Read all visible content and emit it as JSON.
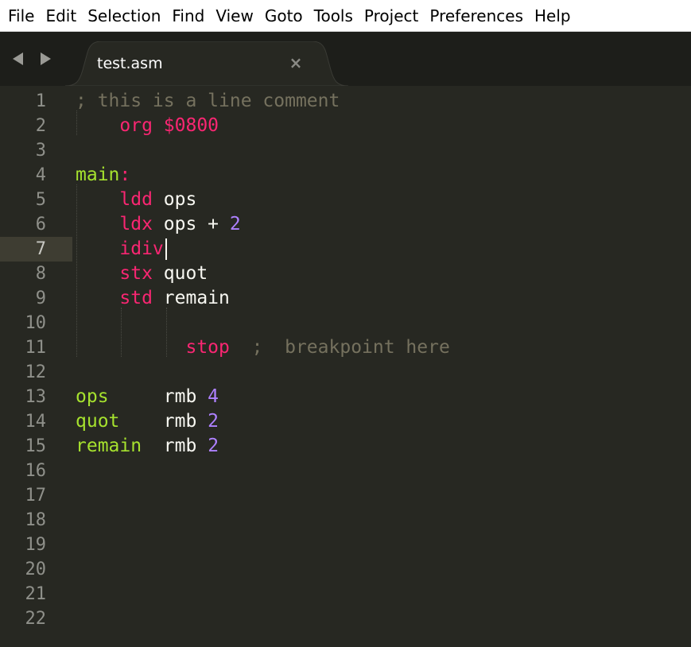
{
  "menu": [
    "File",
    "Edit",
    "Selection",
    "Find",
    "View",
    "Goto",
    "Tools",
    "Project",
    "Preferences",
    "Help"
  ],
  "tab": {
    "title": "test.asm",
    "close_symbol": "×"
  },
  "editor": {
    "active_line": 7,
    "lines": [
      {
        "n": "1",
        "tokens": [
          {
            "t": "; this is a line comment",
            "c": "comment"
          }
        ]
      },
      {
        "n": "2",
        "tokens": [
          {
            "t": "    ",
            "c": "plain"
          },
          {
            "t": "org",
            "c": "keyword"
          },
          {
            "t": " ",
            "c": "plain"
          },
          {
            "t": "$0800",
            "c": "keyword"
          }
        ]
      },
      {
        "n": "3",
        "tokens": []
      },
      {
        "n": "4",
        "tokens": [
          {
            "t": "main",
            "c": "label"
          },
          {
            "t": ":",
            "c": "keyword"
          }
        ]
      },
      {
        "n": "5",
        "tokens": [
          {
            "t": "    ",
            "c": "plain"
          },
          {
            "t": "ldd",
            "c": "keyword"
          },
          {
            "t": " ops",
            "c": "plain"
          }
        ]
      },
      {
        "n": "6",
        "tokens": [
          {
            "t": "    ",
            "c": "plain"
          },
          {
            "t": "ldx",
            "c": "keyword"
          },
          {
            "t": " ops + ",
            "c": "plain"
          },
          {
            "t": "2",
            "c": "number"
          }
        ]
      },
      {
        "n": "7",
        "tokens": [
          {
            "t": "    ",
            "c": "plain"
          },
          {
            "t": "idiv",
            "c": "keyword"
          }
        ]
      },
      {
        "n": "8",
        "tokens": [
          {
            "t": "    ",
            "c": "plain"
          },
          {
            "t": "stx",
            "c": "keyword"
          },
          {
            "t": " quot",
            "c": "plain"
          }
        ]
      },
      {
        "n": "9",
        "tokens": [
          {
            "t": "    ",
            "c": "plain"
          },
          {
            "t": "std",
            "c": "keyword"
          },
          {
            "t": " remain",
            "c": "plain"
          }
        ]
      },
      {
        "n": "10",
        "tokens": []
      },
      {
        "n": "11",
        "tokens": [
          {
            "t": "          ",
            "c": "plain"
          },
          {
            "t": "stop",
            "c": "keyword"
          },
          {
            "t": "  ;  breakpoint here",
            "c": "comment"
          }
        ]
      },
      {
        "n": "12",
        "tokens": []
      },
      {
        "n": "13",
        "tokens": [
          {
            "t": "ops",
            "c": "label"
          },
          {
            "t": "     rmb ",
            "c": "plain"
          },
          {
            "t": "4",
            "c": "number"
          }
        ]
      },
      {
        "n": "14",
        "tokens": [
          {
            "t": "quot",
            "c": "label"
          },
          {
            "t": "    rmb ",
            "c": "plain"
          },
          {
            "t": "2",
            "c": "number"
          }
        ]
      },
      {
        "n": "15",
        "tokens": [
          {
            "t": "remain",
            "c": "label"
          },
          {
            "t": "  rmb ",
            "c": "plain"
          },
          {
            "t": "2",
            "c": "number"
          }
        ]
      },
      {
        "n": "16",
        "tokens": []
      },
      {
        "n": "17",
        "tokens": []
      },
      {
        "n": "18",
        "tokens": []
      },
      {
        "n": "19",
        "tokens": []
      },
      {
        "n": "20",
        "tokens": []
      },
      {
        "n": "21",
        "tokens": []
      },
      {
        "n": "22",
        "tokens": []
      }
    ]
  },
  "colors": {
    "background": "#272822",
    "comment": "#75715e",
    "keyword": "#f92672",
    "number": "#ae81ff",
    "label": "#a6e22e",
    "text": "#f8f8f2"
  }
}
